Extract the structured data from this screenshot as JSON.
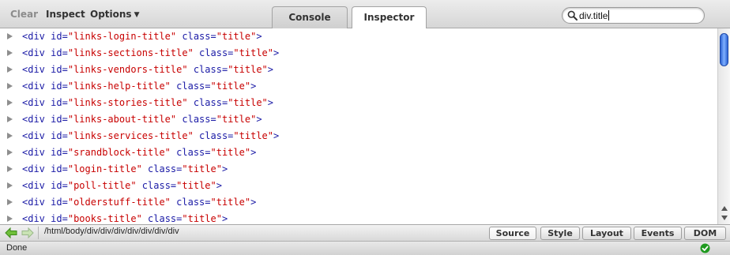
{
  "toolbar": {
    "clear_label": "Clear",
    "inspect_label": "Inspect",
    "options_label": "Options",
    "tabs": [
      {
        "label": "Console",
        "selected": false
      },
      {
        "label": "Inspector",
        "selected": true
      }
    ],
    "search": {
      "value": "div.title",
      "icon": "search-icon"
    }
  },
  "inspector": {
    "rows": [
      {
        "tag": "div",
        "id": "links-login-title",
        "class": "title"
      },
      {
        "tag": "div",
        "id": "links-sections-title",
        "class": "title"
      },
      {
        "tag": "div",
        "id": "links-vendors-title",
        "class": "title"
      },
      {
        "tag": "div",
        "id": "links-help-title",
        "class": "title"
      },
      {
        "tag": "div",
        "id": "links-stories-title",
        "class": "title"
      },
      {
        "tag": "div",
        "id": "links-about-title",
        "class": "title"
      },
      {
        "tag": "div",
        "id": "links-services-title",
        "class": "title"
      },
      {
        "tag": "div",
        "id": "srandblock-title",
        "class": "title"
      },
      {
        "tag": "div",
        "id": "login-title",
        "class": "title"
      },
      {
        "tag": "div",
        "id": "poll-title",
        "class": "title"
      },
      {
        "tag": "div",
        "id": "olderstuff-title",
        "class": "title"
      },
      {
        "tag": "div",
        "id": "books-title",
        "class": "title"
      }
    ]
  },
  "bottombar": {
    "breadcrumb": "/html/body/div/div/div/div/div/div/div",
    "panels": [
      {
        "label": "Source",
        "selected": true
      },
      {
        "label": "Style",
        "selected": false
      },
      {
        "label": "Layout",
        "selected": false
      },
      {
        "label": "Events",
        "selected": false
      },
      {
        "label": "DOM",
        "selected": false
      }
    ]
  },
  "status": {
    "text": "Done",
    "icon": "checkmark-icon",
    "color": "#1f9a1f"
  },
  "colors": {
    "tag": "#1a1aa6",
    "attr_value": "#c80000",
    "scroll_thumb": "#3a73e6"
  }
}
